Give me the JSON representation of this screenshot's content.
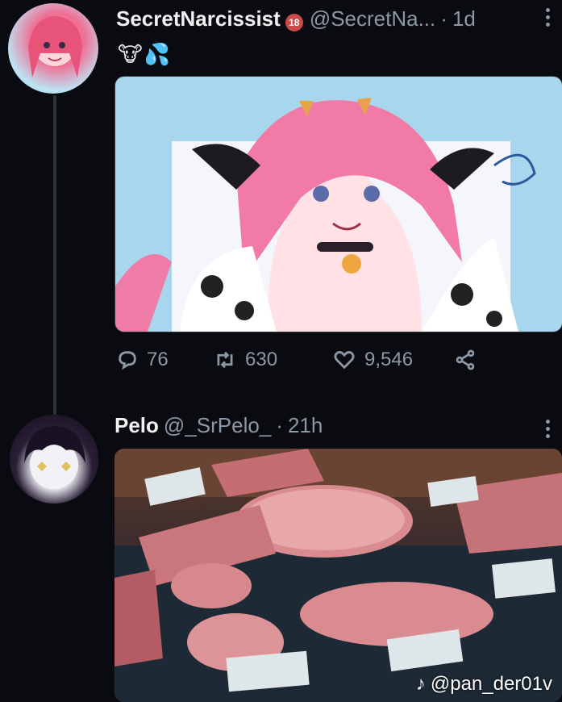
{
  "tweet1": {
    "name": "SecretNarcissist",
    "handle": "@SecretNa...",
    "separator": "·",
    "time": "1d",
    "emoji": "🐮💦",
    "stats": {
      "replies": "76",
      "retweets": "630",
      "likes": "9,546"
    }
  },
  "tweet2": {
    "name": "Pelo",
    "handle": "@_SrPelo_",
    "separator": "·",
    "time": "21h"
  },
  "watermark": {
    "text": "@pan_der01v"
  },
  "colors": {
    "background": "#0a0b10",
    "muted": "#8b98a5",
    "text": "#e7e9ea"
  }
}
